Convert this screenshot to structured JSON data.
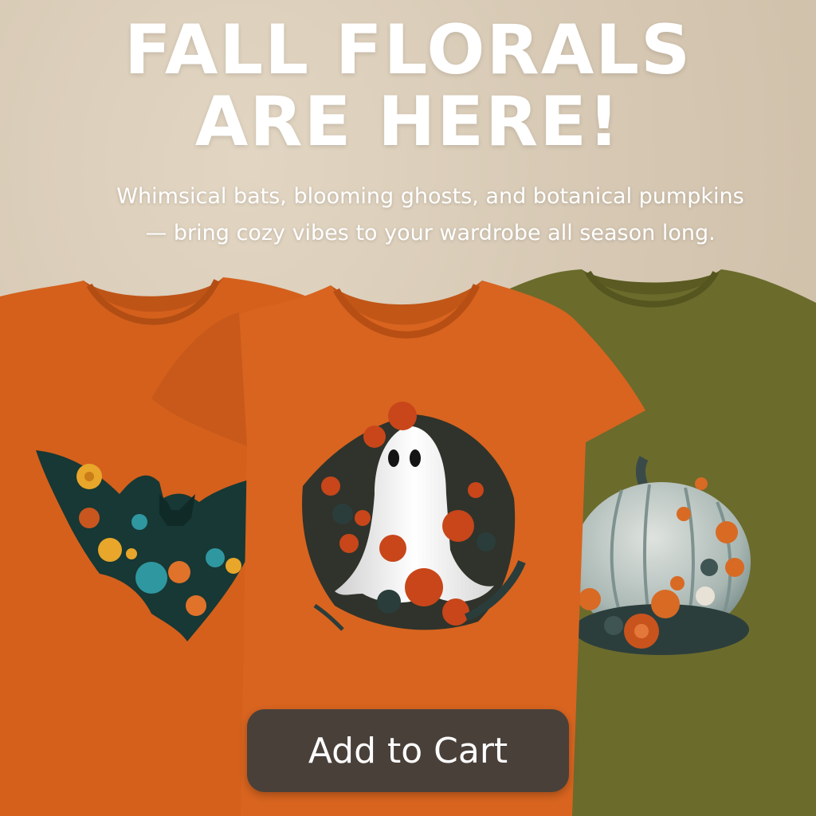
{
  "banner": {
    "headline_line1": "FALL FLORALS",
    "headline_line2": "ARE HERE!",
    "subtitle_line1": "Whimsical bats, blooming ghosts, and botanical pumpkins",
    "subtitle_line2": "— bring cozy vibes to your wardrobe all season long."
  },
  "products": [
    {
      "design": "floral-bat",
      "shirt_color": "#d4601c"
    },
    {
      "design": "floral-ghost",
      "shirt_color": "#d8641f"
    },
    {
      "design": "botanical-pumpkin",
      "shirt_color": "#6b6b2c"
    }
  ],
  "cta": {
    "label": "Add to Cart",
    "color": "#4a403a"
  }
}
